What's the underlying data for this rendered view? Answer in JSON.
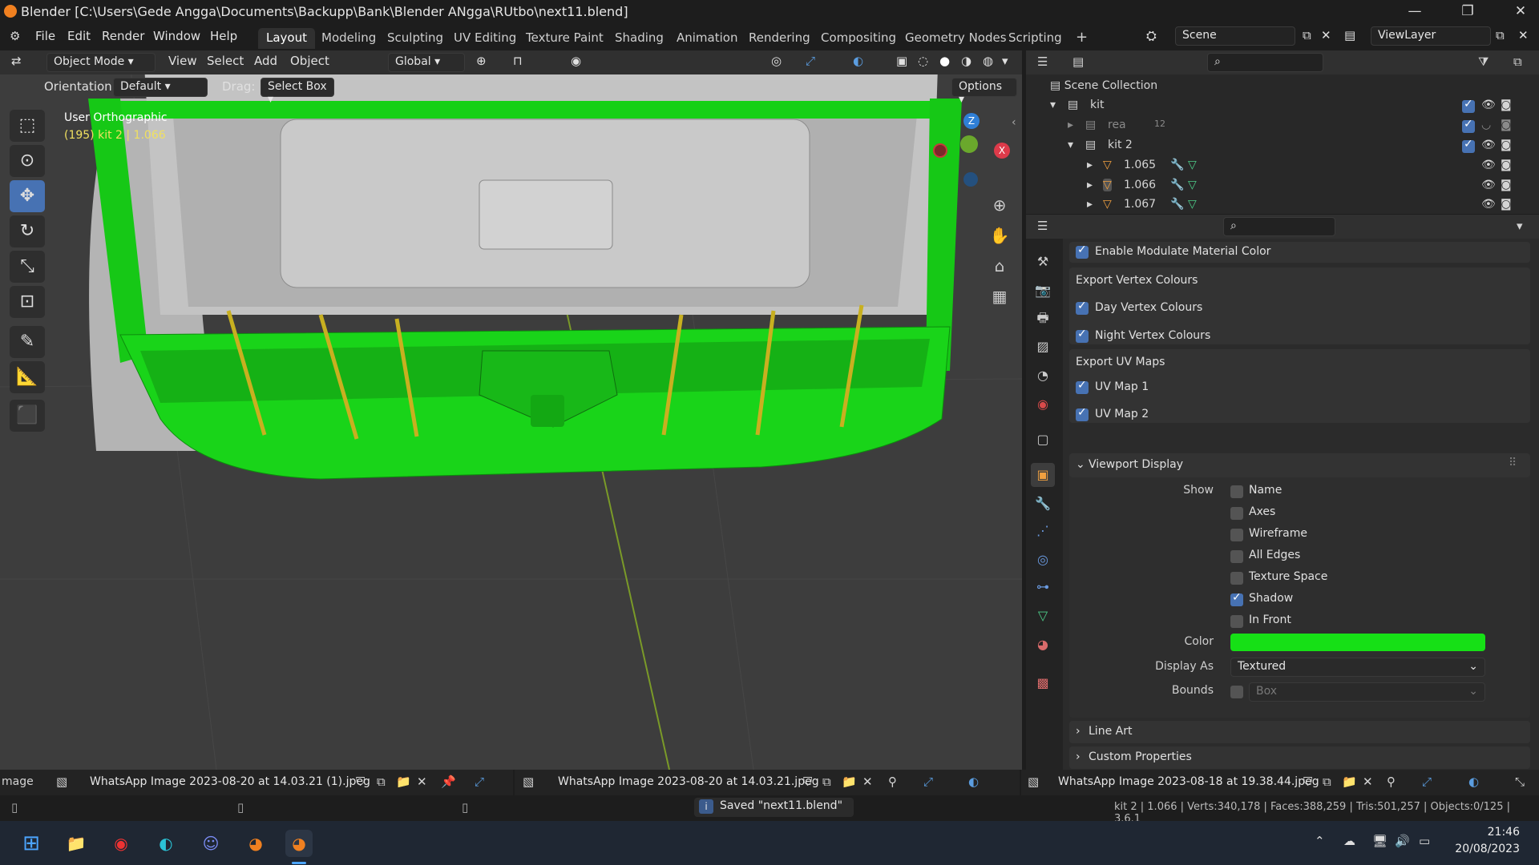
{
  "window": {
    "title": "Blender [C:\\Users\\Gede Angga\\Documents\\Backupp\\Bank\\Blender ANgga\\RUtbo\\next11.blend]",
    "minimize": "—",
    "maximize": "❐",
    "close": "✕"
  },
  "menu": [
    "File",
    "Edit",
    "Render",
    "Window",
    "Help"
  ],
  "workspaces": [
    "Layout",
    "Modeling",
    "Sculpting",
    "UV Editing",
    "Texture Paint",
    "Shading",
    "Animation",
    "Rendering",
    "Compositing",
    "Geometry Nodes",
    "Scripting",
    "+"
  ],
  "active_workspace": "Layout",
  "scene": {
    "name": "Scene",
    "view_layer": "ViewLayer"
  },
  "viewport": {
    "mode": "Object Mode",
    "menus": [
      "View",
      "Select",
      "Add",
      "Object"
    ],
    "transform": "Global",
    "orientation_label": "Orientation:",
    "orientation_value": "Default",
    "drag_label": "Drag:",
    "drag_value": "Select Box",
    "options": "Options",
    "view_name": "User Orthographic",
    "object_info": "(195) kit 2 | 1.066",
    "gizmo": {
      "z": "Z",
      "y": "Y",
      "x": "X"
    }
  },
  "outliner": {
    "root": "Scene Collection",
    "items": [
      {
        "name": "kit",
        "level": 1
      },
      {
        "name": "rea",
        "level": 2,
        "badge": "12"
      },
      {
        "name": "kit 2",
        "level": 2
      },
      {
        "name": "1.065",
        "level": 3
      },
      {
        "name": "1.066",
        "level": 3
      },
      {
        "name": "1.067",
        "level": 3
      }
    ]
  },
  "properties": {
    "modulate": "Enable Modulate Material Color",
    "vertex_header": "Export Vertex Colours",
    "day": "Day Vertex Colours",
    "night": "Night Vertex Colours",
    "uv_header": "Export UV Maps",
    "uv1": "UV Map 1",
    "uv2": "UV Map 2",
    "viewport_display": "Viewport Display",
    "show_label": "Show",
    "show_items": [
      {
        "label": "Name",
        "checked": false
      },
      {
        "label": "Axes",
        "checked": false
      },
      {
        "label": "Wireframe",
        "checked": false
      },
      {
        "label": "All Edges",
        "checked": false
      },
      {
        "label": "Texture Space",
        "checked": false
      },
      {
        "label": "Shadow",
        "checked": true
      },
      {
        "label": "In Front",
        "checked": false
      }
    ],
    "color_label": "Color",
    "color_value": "#16e016",
    "display_as_label": "Display As",
    "display_as_value": "Textured",
    "bounds_label": "Bounds",
    "bounds_value": "Box",
    "line_art": "Line Art",
    "custom_properties": "Custom Properties"
  },
  "image_editors": [
    {
      "prefix": "mage",
      "name": "WhatsApp Image 2023-08-20 at 14.03.21 (1).jpeg"
    },
    {
      "name": "WhatsApp Image 2023-08-20 at 14.03.21.jpeg"
    },
    {
      "name": "WhatsApp Image 2023-08-18 at 19.38.44.jpeg"
    }
  ],
  "status": {
    "message": "Saved \"next11.blend\"",
    "stats": "kit 2 | 1.066 | Verts:340,178 | Faces:388,259 | Tris:501,257 | Objects:0/125 | 3.6.1"
  },
  "taskbar": {
    "time": "21:46",
    "date": "20/08/2023"
  },
  "colors": {
    "accent": "#4772b3",
    "car_green": "#16e016",
    "blender_orange": "#f08020"
  }
}
